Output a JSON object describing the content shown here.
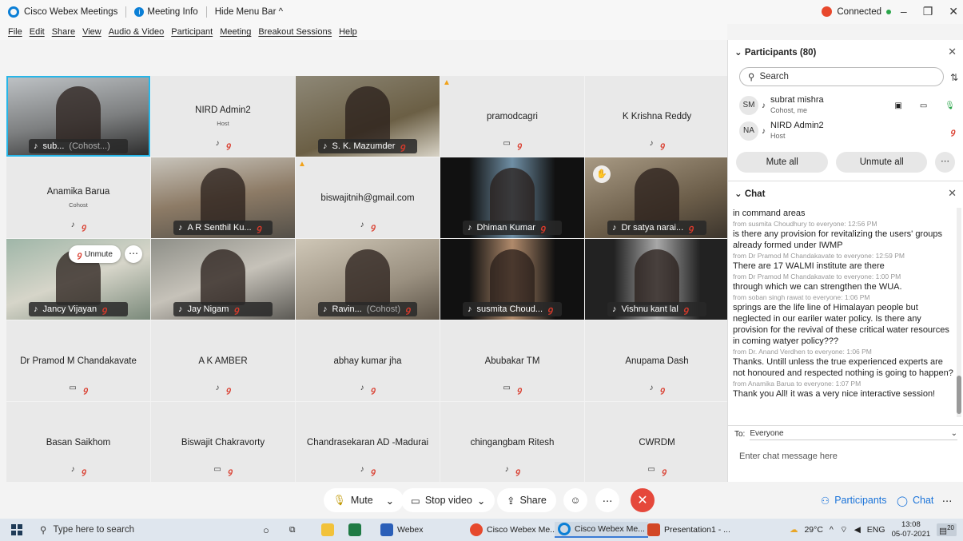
{
  "titlebar": {
    "app_name": "Cisco Webex Meetings",
    "meeting_info": "Meeting Info",
    "hide_menu": "Hide Menu Bar ^",
    "status": "Connected"
  },
  "menu": [
    "File",
    "Edit",
    "Share",
    "View",
    "Audio & Video",
    "Participant",
    "Meeting",
    "Breakout Sessions",
    "Help"
  ],
  "tiles": [
    {
      "name": "sub...",
      "extra": "(Cohost...)",
      "type": "video",
      "style": "v1",
      "active": true
    },
    {
      "name": "NIRD Admin2",
      "sub": "Host",
      "type": "blank"
    },
    {
      "name": "S. K. Mazumder",
      "type": "video",
      "style": "v2"
    },
    {
      "name": "pramodcagri",
      "type": "blank",
      "warn": true
    },
    {
      "name": "K Krishna Reddy",
      "type": "blank"
    },
    {
      "name": "Anamika Barua",
      "sub": "Cohost",
      "type": "blank"
    },
    {
      "name": "A R Senthil Ku...",
      "type": "video",
      "style": "v3"
    },
    {
      "name": "biswajitnih@gmail.com",
      "type": "blank",
      "warn": true
    },
    {
      "name": "Dhiman Kumar",
      "type": "video",
      "style": "v5"
    },
    {
      "name": "Dr satya narai...",
      "type": "video",
      "style": "v6"
    },
    {
      "name": "Jancy Vijayan",
      "type": "video",
      "style": "v7"
    },
    {
      "name": "Jay Nigam",
      "type": "video",
      "style": "v8"
    },
    {
      "name": "Ravin...",
      "extra": "(Cohost)",
      "type": "video",
      "style": "v9"
    },
    {
      "name": "susmita Choud...",
      "type": "video",
      "style": "v10"
    },
    {
      "name": "Vishnu kant lal",
      "type": "video",
      "style": "v11"
    },
    {
      "name": "Dr Pramod M Chandakavate",
      "type": "blank"
    },
    {
      "name": "A K AMBER",
      "type": "blank"
    },
    {
      "name": "abhay kumar jha",
      "type": "blank"
    },
    {
      "name": "Abubakar TM",
      "type": "blank"
    },
    {
      "name": "Anupama Dash",
      "type": "blank"
    },
    {
      "name": "Basan Saikhom",
      "type": "blank"
    },
    {
      "name": "Biswajit Chakravorty",
      "type": "blank"
    },
    {
      "name": "Chandrasekaran AD -Madurai",
      "type": "blank"
    },
    {
      "name": "chingangbam Ritesh",
      "type": "blank"
    },
    {
      "name": "CWRDM",
      "type": "blank"
    }
  ],
  "unmute_label": "Unmute",
  "participants": {
    "header": "Participants (80)",
    "search_placeholder": "Search",
    "list": [
      {
        "initials": "SM",
        "name": "subrat mishra",
        "role": "Cohost, me"
      },
      {
        "initials": "NA",
        "name": "NIRD Admin2",
        "role": "Host"
      }
    ],
    "mute_all": "Mute all",
    "unmute_all": "Unmute all"
  },
  "chat": {
    "header": "Chat",
    "messages": [
      {
        "from": "",
        "text": "in command areas"
      },
      {
        "from": "from susmita Choudhury to everyone:   12:56 PM",
        "text": "is there any provision for revitalizing the users' groups already formed under IWMP"
      },
      {
        "from": "from  Dr Pramod M Chandakavate to everyone:   12:59 PM",
        "text": "There are 17 WALMI institute are there"
      },
      {
        "from": "from  Dr Pramod M Chandakavate to everyone:   1:00 PM",
        "text": "through which we can strengthen the WUA."
      },
      {
        "from": "from soban singh rawat to everyone:   1:06 PM",
        "text": "springs are the life line of Himalayan people but neglected in our eariler water policy. Is there any provision for the revival of these critical water resources in coming watyer policy???"
      },
      {
        "from": "from Dr. Anand Verdhen to everyone:   1:06 PM",
        "text": "Thanks. Untill unless the true experienced experts are not honoured and respected nothing is going to happen?"
      },
      {
        "from": "from Anamika Barua to everyone:   1:07 PM",
        "text": "Thank you All! it was a very nice interactive session!"
      }
    ],
    "to_label": "To:",
    "to_value": "Everyone",
    "input_placeholder": "Enter chat message here"
  },
  "controls": {
    "mute": "Mute",
    "stop_video": "Stop video",
    "share": "Share",
    "participants": "Participants",
    "chat": "Chat"
  },
  "taskbar": {
    "search_placeholder": "Type here to search",
    "apps": [
      "Webex",
      "Cisco Webex Me...",
      "Cisco Webex Me...",
      "Presentation1 - ..."
    ],
    "temperature": "29°C",
    "lang": "ENG",
    "time": "13:08",
    "date": "05-07-2021",
    "notif_count": "20"
  }
}
